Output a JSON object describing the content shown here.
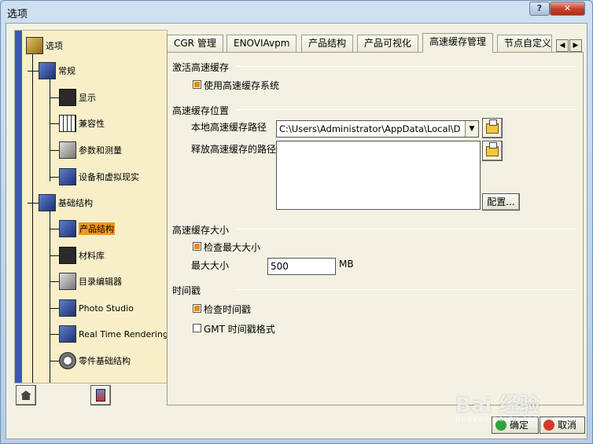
{
  "window": {
    "title": "选项",
    "help_label": "?",
    "close_label": "✕"
  },
  "tree": {
    "items": [
      {
        "label": "选项",
        "icon": "options-icon"
      },
      {
        "label": "常规",
        "icon": "general-icon"
      },
      {
        "label": "显示",
        "icon": "display-icon"
      },
      {
        "label": "兼容性",
        "icon": "compatibility-icon"
      },
      {
        "label": "参数和测量",
        "icon": "parameters-icon"
      },
      {
        "label": "设备和虚拟现实",
        "icon": "devices-vr-icon"
      },
      {
        "label": "基础结构",
        "icon": "infrastructure-icon"
      },
      {
        "label": "产品结构",
        "icon": "product-structure-icon",
        "selected": true
      },
      {
        "label": "材料库",
        "icon": "material-library-icon"
      },
      {
        "label": "目录编辑器",
        "icon": "catalog-editor-icon"
      },
      {
        "label": "Photo Studio",
        "icon": "photo-studio-icon"
      },
      {
        "label": "Real Time Rendering",
        "icon": "real-time-rendering-icon"
      },
      {
        "label": "零件基础结构",
        "icon": "part-infrastructure-icon"
      }
    ]
  },
  "tabs": [
    {
      "label": "CGR 管理"
    },
    {
      "label": "ENOVIAvpm"
    },
    {
      "label": "产品结构"
    },
    {
      "label": "产品可视化"
    },
    {
      "label": "高速缓存管理",
      "active": true
    },
    {
      "label": "节点自定义"
    }
  ],
  "cache": {
    "activate_title": "激活高速缓存",
    "use_cache_label": "使用高速缓存系统",
    "use_cache_checked": true,
    "location_title": "高速缓存位置",
    "local_path_label": "本地高速缓存路径",
    "local_path_value": "C:\\Users\\Administrator\\AppData\\Local\\D",
    "release_path_label": "释放高速缓存的路径",
    "config_button": "配置...",
    "size_title": "高速缓存大小",
    "check_max_label": "检查最大大小",
    "check_max_checked": true,
    "max_size_label": "最大大小",
    "max_size_value": "500",
    "max_size_unit": "MB",
    "timestamp_title": "时间戳",
    "check_timestamp_label": "检查时间戳",
    "check_timestamp_checked": true,
    "gmt_label": "GMT 时间戳格式",
    "gmt_checked": false
  },
  "buttons": {
    "ok": "确定",
    "cancel": "取消"
  },
  "watermark": {
    "main": "Bai 经验",
    "sub": "jingyan.baidu.com"
  }
}
